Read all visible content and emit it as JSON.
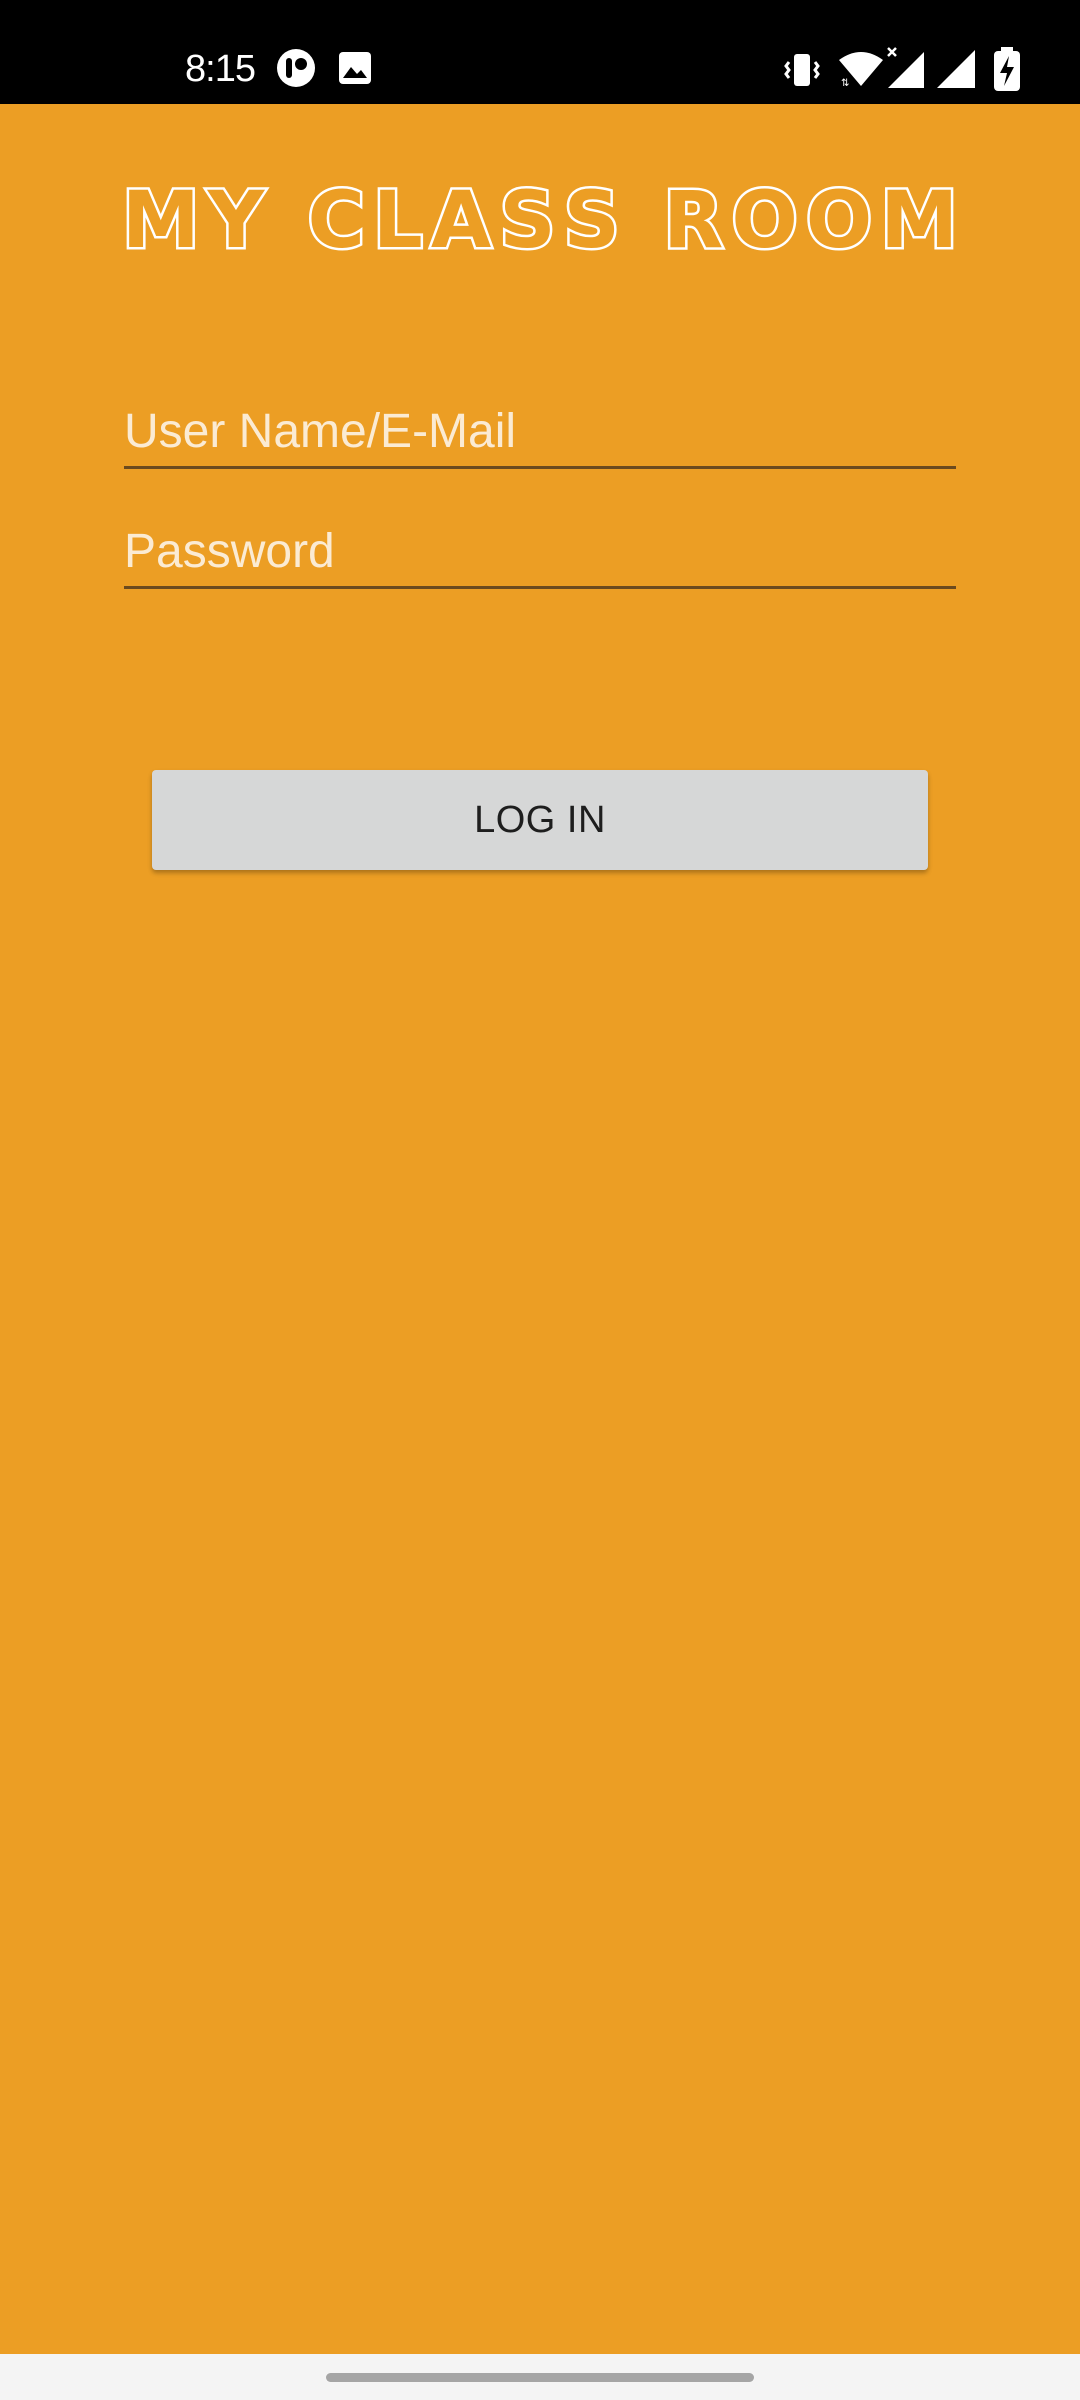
{
  "status_bar": {
    "time": "8:15",
    "left_icons": [
      "notification-app-icon",
      "image-icon"
    ],
    "right_icons": [
      "vibrate-icon",
      "wifi-icon",
      "cell-signal-x-icon",
      "cell-signal-icon",
      "battery-charging-icon"
    ]
  },
  "app": {
    "title": "MY CLASS ROOM",
    "title_color": "#FFFFFF",
    "background_color": "#EC9E24"
  },
  "login_form": {
    "username": {
      "value": "",
      "placeholder": "User Name/E-Mail"
    },
    "password": {
      "value": "",
      "placeholder": "Password"
    },
    "login_button_label": "LOG IN"
  }
}
